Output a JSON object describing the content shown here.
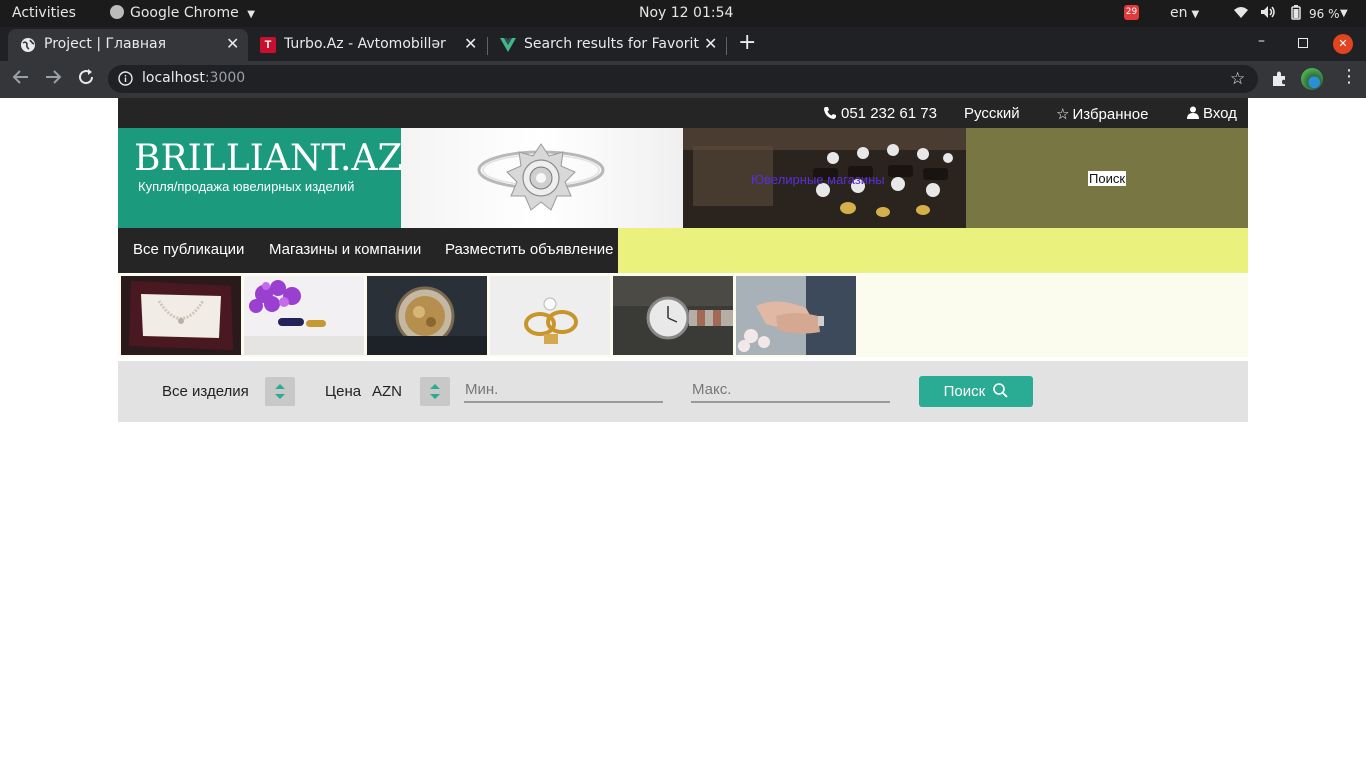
{
  "system_bar": {
    "activities": "Activities",
    "app_name": "Google Chrome",
    "datetime": "Noy 12  01:54",
    "notification_count": "29",
    "language": "en",
    "battery": "96 %"
  },
  "browser": {
    "tabs": [
      {
        "title": "Project | Главная",
        "active": true
      },
      {
        "title": "Turbo.Az - Avtomobillər",
        "active": false
      },
      {
        "title": "Search results for Favorit",
        "active": false
      }
    ],
    "url_host": "localhost",
    "url_port": ":3000"
  },
  "site": {
    "topbar": {
      "phone": "051 232 61 73",
      "language": "Русский",
      "favorites": "Избранное",
      "login": "Вход"
    },
    "logo": {
      "title": "BRILLIANT.AZ",
      "subtitle": "Купля/продажа ювелирных изделий"
    },
    "banner": {
      "shops_label": "Ювелирные магазины",
      "search_label": "Поиск"
    },
    "nav": {
      "items": [
        "Все публикации",
        "Магазины и компании",
        "Разместить объявление"
      ]
    },
    "filter": {
      "category": "Все изделия",
      "price_label": "Цена",
      "currency": "AZN",
      "min_placeholder": "Мин.",
      "max_placeholder": "Макс.",
      "search_button": "Поиск"
    },
    "colors": {
      "brand_green": "#1b9a7e",
      "nav_yellow": "#eaf17d",
      "button_teal": "#2aab94",
      "dark": "#252525"
    }
  }
}
